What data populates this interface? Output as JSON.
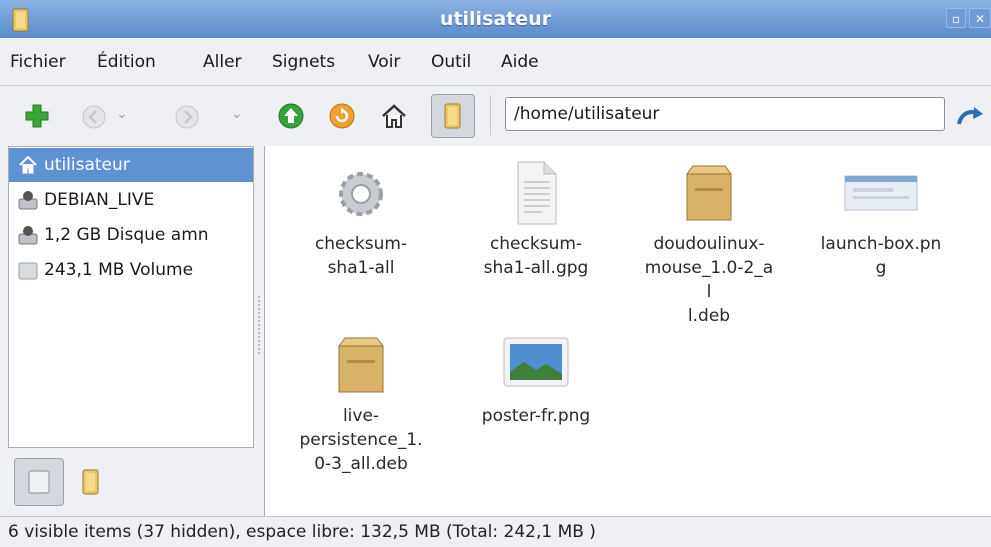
{
  "window": {
    "title": "utilisateur",
    "accent": "#5f92d3"
  },
  "menu": [
    "Fichier",
    "Édition",
    "Aller",
    "Signets",
    "Voir",
    "Outil",
    "Aide"
  ],
  "toolbar": {
    "location_value": "/home/utilisateur",
    "icons": [
      "add-icon",
      "back-icon",
      "forward-icon",
      "up-icon",
      "reload-icon",
      "home-icon",
      "trash-icon",
      "go-icon"
    ]
  },
  "sidebar": {
    "items": [
      {
        "label": "utilisateur",
        "icon": "home-icon",
        "selected": true
      },
      {
        "label": "DEBIAN_LIVE",
        "icon": "drive-icon"
      },
      {
        "label": "1,2 GB Disque amn",
        "icon": "drive-icon"
      },
      {
        "label": "243,1 MB Volume",
        "icon": "volume-icon"
      }
    ]
  },
  "files": [
    {
      "name": "checksum-sha1-all",
      "lines": [
        "checksum-",
        "sha1-all"
      ],
      "icon": "gear-file-icon"
    },
    {
      "name": "checksum-sha1-all.gpg",
      "lines": [
        "checksum-",
        "sha1-all.gpg"
      ],
      "icon": "text-file-icon"
    },
    {
      "name": "doudoulinux-mouse_1.0-2_all.deb",
      "lines": [
        "doudoulinux-",
        "mouse_1.0-2_al",
        "l.deb"
      ],
      "icon": "package-icon"
    },
    {
      "name": "launch-box.png",
      "lines": [
        "launch-box.png"
      ],
      "icon": "image-icon"
    },
    {
      "name": "live-persistence_1.0-3_all.deb",
      "lines": [
        "live-",
        "persistence_1.",
        "0-3_all.deb"
      ],
      "icon": "package-icon"
    },
    {
      "name": "poster-fr.png",
      "lines": [
        "poster-fr.png"
      ],
      "icon": "photo-icon"
    }
  ],
  "status": "6 visible items (37 hidden), espace libre: 132,5 MB (Total: 242,1 MB )"
}
